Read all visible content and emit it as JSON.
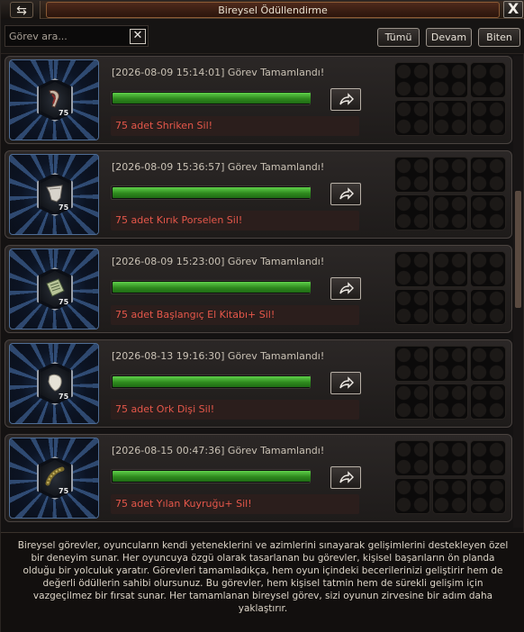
{
  "window": {
    "title": "Bireysel Ödüllendirme",
    "close_label": "X",
    "swap_icon": "swap-arrows-icon"
  },
  "search": {
    "placeholder": "Görev ara...",
    "value": "",
    "clear_label": "✕"
  },
  "filters": [
    {
      "label": "Tümü"
    },
    {
      "label": "Devam"
    },
    {
      "label": "Biten"
    }
  ],
  "quests": [
    {
      "timestamp": "[2026-08-09 15:14:01]",
      "status": "Görev Tamamlandı!",
      "objective": "75 adet Shriken Sil!",
      "count": "75",
      "item_icon": "shuriken-icon",
      "progress": 1.0
    },
    {
      "timestamp": "[2026-08-09 15:36:57]",
      "status": "Görev Tamamlandı!",
      "objective": "75 adet Kırık Porselen Sil!",
      "count": "75",
      "item_icon": "broken-porcelain-icon",
      "progress": 1.0
    },
    {
      "timestamp": "[2026-08-09 15:23:00]",
      "status": "Görev Tamamlandı!",
      "objective": "75 adet Başlangıç El Kitabı+ Sil!",
      "count": "75",
      "item_icon": "handbook-icon",
      "progress": 1.0
    },
    {
      "timestamp": "[2026-08-13 19:16:30]",
      "status": "Görev Tamamlandı!",
      "objective": "75 adet Ork Dişi Sil!",
      "count": "75",
      "item_icon": "orc-tooth-icon",
      "progress": 1.0
    },
    {
      "timestamp": "[2026-08-15 00:47:36]",
      "status": "Görev Tamamlandı!",
      "objective": "75 adet Yılan Kuyruğu+ Sil!",
      "count": "75",
      "item_icon": "snake-tail-icon",
      "progress": 1.0
    }
  ],
  "description": "Bireysel görevler, oyuncuların kendi yeteneklerini ve azimlerini sınayarak gelişimlerini destekleyen özel bir deneyim sunar. Her oyuncuya özgü olarak tasarlanan bu görevler, kişisel başarıların ön planda olduğu bir yolculuk yaratır. Görevleri tamamladıkça, hem oyun içindeki becerilerinizi geliştirir hem de değerli ödüllerin sahibi olursunuz. Bu görevler, hem kişisel tatmin hem de sürekli gelişim için vazgeçilmez bir fırsat sunar. Her tamamlanan bireysel görev, sizi oyunun zirvesine bir adım daha yaklaştırır.",
  "colors": {
    "objective_text": "#e5574a",
    "progress_green": "#3fa52a",
    "icon_frame_blue": "#1d3354"
  }
}
